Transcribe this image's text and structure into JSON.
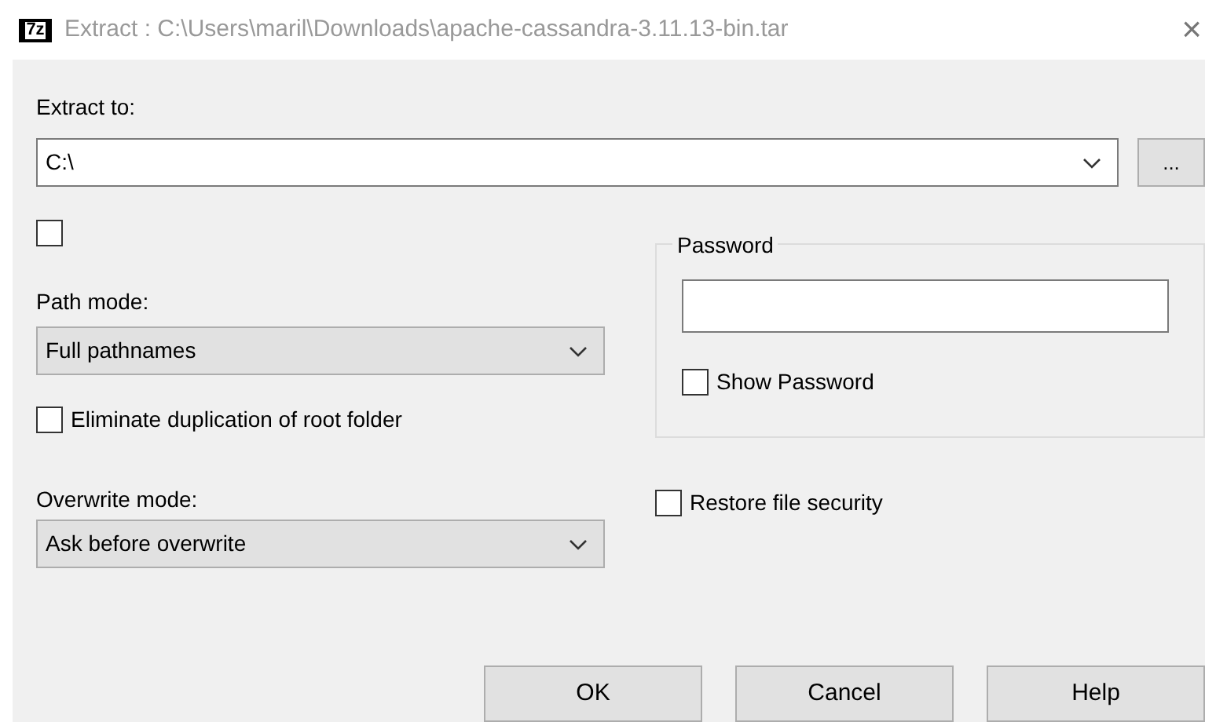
{
  "window": {
    "app_icon_text": "7z",
    "title": "Extract : C:\\Users\\maril\\Downloads\\apache-cassandra-3.11.13-bin.tar",
    "close": "×"
  },
  "extract_to": {
    "label": "Extract to:",
    "value": "C:\\",
    "browse": "..."
  },
  "unlabeled_checkbox": {
    "checked": false
  },
  "path_mode": {
    "label": "Path mode:",
    "value": "Full pathnames"
  },
  "eliminate_duplication": {
    "label": "Eliminate duplication of root folder",
    "checked": false
  },
  "overwrite_mode": {
    "label": "Overwrite mode:",
    "value": "Ask before overwrite"
  },
  "password": {
    "legend": "Password",
    "show_password": {
      "label": "Show Password",
      "checked": false
    }
  },
  "restore_security": {
    "label": "Restore file security",
    "checked": false
  },
  "buttons": [
    "OK",
    "Cancel",
    "Help"
  ]
}
